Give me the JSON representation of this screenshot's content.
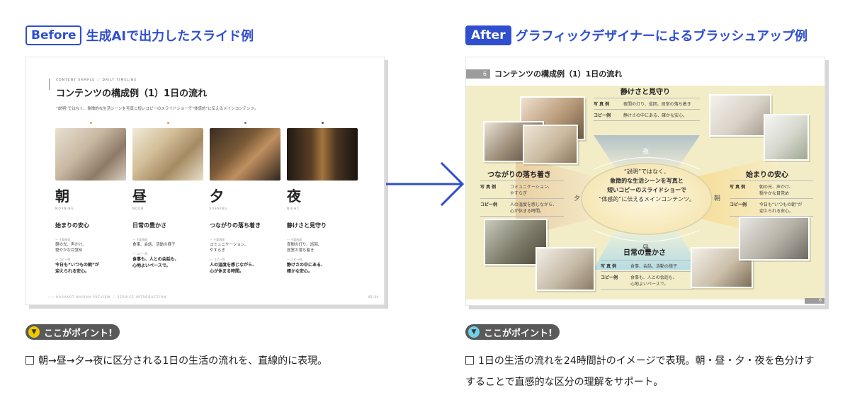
{
  "before": {
    "tag": "Before",
    "heading": "生成AIで出力したスライド例",
    "slide": {
      "crumb": "CONTENT SAMPLE ／ DAILY TIMELINE",
      "title": "コンテンツの構成例（1）1日の流れ",
      "subtitle": "“説明”ではなく、象徴的な生活シーンを写真と短いコピーのスライドショーで“体感的”に伝えるメインコンテンツ。",
      "footer_left": "—— HARAKOT NAIKAN PREVIEW ／ SERVICE INTRODUCTION",
      "page": "05 / 04",
      "columns": [
        {
          "kanji": "朝",
          "roman": "MORNING",
          "title": "始まりの安心",
          "label1": "— 主要画面",
          "text1a": "朝の光、声かけ、",
          "text1b": "穏やかな目覚め",
          "label2": "— コピー例",
          "copy_a": "今日も“いつもの朝”が",
          "copy_b": "迎えられる安心。"
        },
        {
          "kanji": "昼",
          "roman": "NOON",
          "title": "日常の豊かさ",
          "label1": "— 主要画面",
          "text1a": "食事、会話、活動の様子",
          "text1b": "",
          "label2": "— コピー例",
          "copy_a": "食事も、人との会話も、",
          "copy_b": "心地よいペースで。"
        },
        {
          "kanji": "夕",
          "roman": "EVENING",
          "title": "つながりの落ち着き",
          "label1": "— 主要画面",
          "text1a": "コミュニケーション、",
          "text1b": "やすらぎ",
          "label2": "— コピー例",
          "copy_a": "人の温度を感じながら、",
          "copy_b": "心が休まる時間。"
        },
        {
          "kanji": "夜",
          "roman": "NIGHT",
          "title": "静けさと見守り",
          "label1": "— 主要画面",
          "text1a": "夜間の灯り、巡回、",
          "text1b": "居室の落ち着き",
          "label2": "— コピー例",
          "copy_a": "静けさの中にある、",
          "copy_b": "確かな安心。"
        }
      ]
    },
    "point_label": "ここがポイント!",
    "description": "朝→昼→夕→夜に区分される1日の生活の流れを、直線的に表現。"
  },
  "after": {
    "tag": "After",
    "heading": "グラフィックデザイナーによるブラッシュアップ例",
    "slide": {
      "page_num": "6",
      "title": "コンテンツの構成例（1）1日の流れ",
      "footer_num": "6",
      "center_1": "“説明”ではなく、",
      "center_2": "象徴的な生活シーンを写真と",
      "center_3": "短いコピーのスライドショーで",
      "center_4": "“体感的”に伝えるメインコンテンツ。",
      "segments": {
        "night": "夜",
        "evening": "夕",
        "morning": "朝",
        "noon": "昼"
      },
      "sections": {
        "night": {
          "title": "静けさと見守り",
          "k1": "写 真 例",
          "v1": "夜間の灯り、巡回、居室の落ち着き",
          "k2": "コピー例",
          "v2": "静けさの中にある、確かな安心。"
        },
        "evening": {
          "title": "つながりの落ち着き",
          "k1": "写 真 例",
          "v1a": "コミュニケーション、",
          "v1b": "やすらぎ",
          "k2": "コピー例",
          "v2a": "人の温度を感じながら、",
          "v2b": "心が休まる時間。"
        },
        "morning": {
          "title": "始まりの安心",
          "k1": "写 真 例",
          "v1a": "朝の光、声かけ、",
          "v1b": "穏やかな目覚め",
          "k2": "コピー例",
          "v2a": "今日も“いつもの朝”が",
          "v2b": "迎えられる安心。"
        },
        "noon": {
          "title": "日常の豊かさ",
          "k1": "写 真 例",
          "v1": "食事、会話、活動の様子",
          "k2": "コピー例",
          "v2a": "食事も、人との会話も、",
          "v2b": "心地よいペースで。"
        }
      }
    },
    "point_label": "ここがポイント!",
    "description_1": "1日の生活の流れを24時間計のイメージで表現。朝・昼・夕・夜を色分けす",
    "description_2": "することで直感的な区分の理解をサポート。"
  },
  "colors": {
    "accent": "#2f4fcf",
    "badge_bg": "#5a5a5a",
    "before_icon": "#f2c800",
    "after_icon": "#6fd0e6",
    "after_bg": "#f2edc7"
  }
}
